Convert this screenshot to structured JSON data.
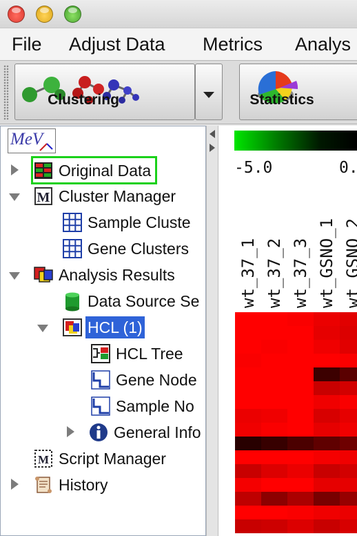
{
  "menu": {
    "items": [
      "File",
      "Adjust Data",
      "Metrics",
      "Analys"
    ]
  },
  "toolbar": {
    "clustering_label": "Clustering",
    "statistics_label": "Statistics"
  },
  "tree": {
    "logo_text": "MeV",
    "original_data": "Original Data",
    "cluster_manager": "Cluster Manager",
    "sample_clusters": "Sample Cluste",
    "gene_clusters": "Gene Clusters",
    "analysis_results": "Analysis Results",
    "data_source": "Data Source Se",
    "hcl": "HCL (1)",
    "hcl_tree": "HCL Tree",
    "gene_nodes": "Gene Node",
    "sample_nodes": "Sample No",
    "general_info": "General Info",
    "script_manager": "Script Manager",
    "history": "History"
  },
  "viewer": {
    "scale_min": "-5.0",
    "scale_mid": "0.",
    "columns": [
      "wt_37_1",
      "wt_37_2",
      "wt_37_3",
      "wt_GSNO_1",
      "wt_GSNO_2"
    ]
  },
  "colors": {
    "selection": "#2f63d8",
    "focus_outline": "#1ad11a",
    "heat_high": "#ff0000",
    "heat_low": "#000000"
  }
}
